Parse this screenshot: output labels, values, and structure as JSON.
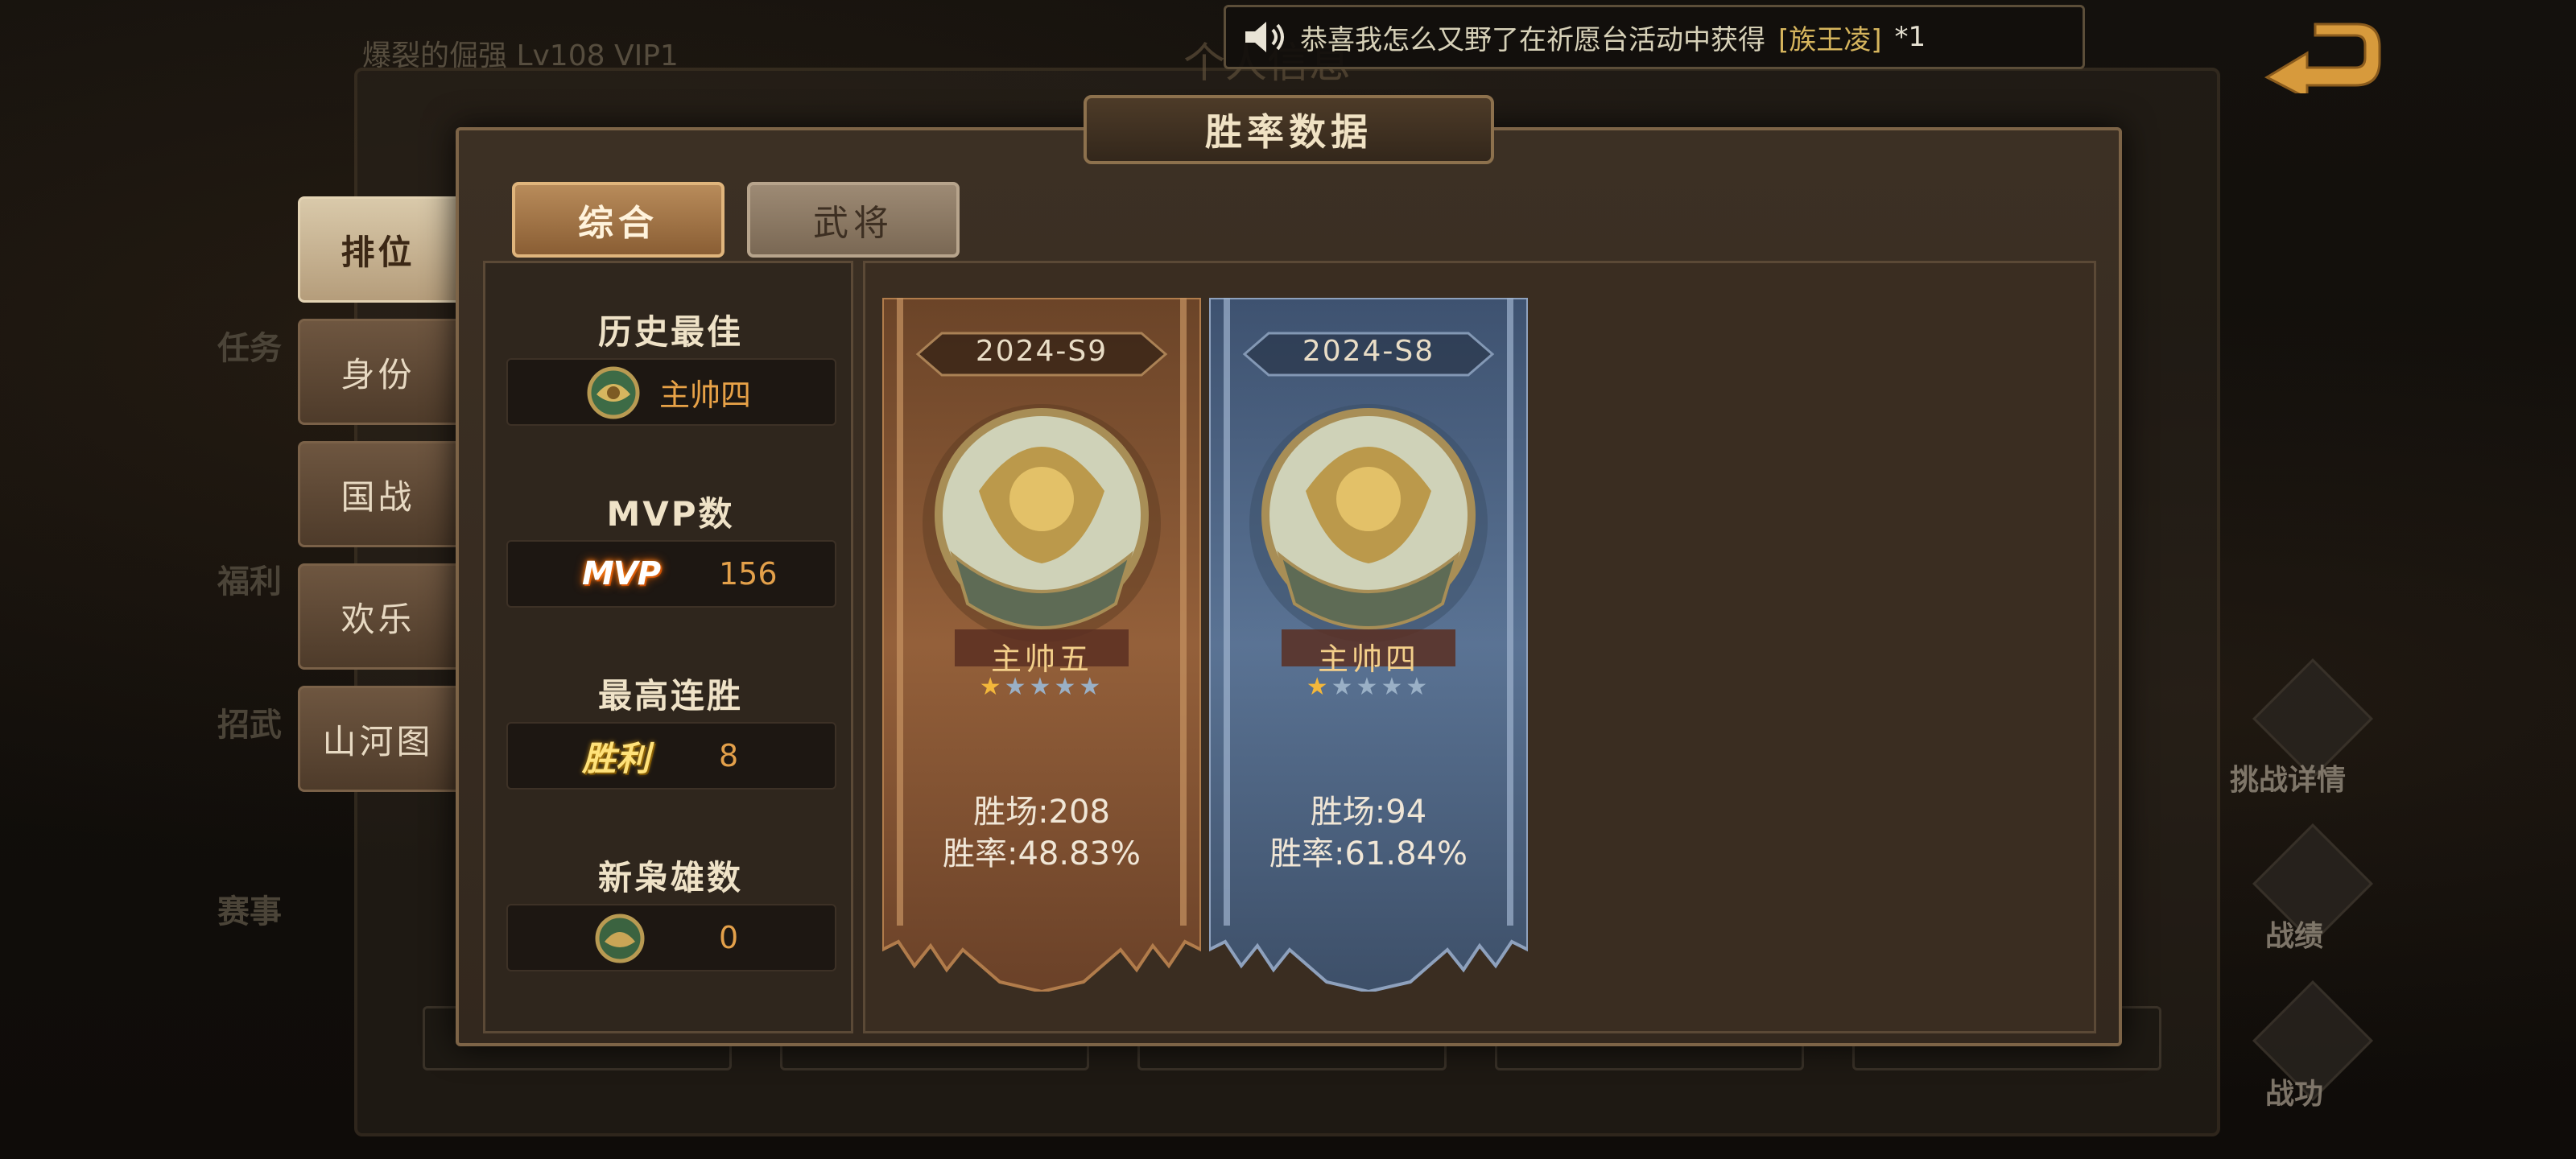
{
  "background": {
    "player_line": "爆裂的倔强 Lv108  VIP1",
    "window_title": "个人信息",
    "left_labels": [
      "任务",
      "福利",
      "招武",
      "赛事"
    ],
    "right_labels": [
      "挑战详情",
      "战绩",
      "战功"
    ]
  },
  "announcement": {
    "prefix": "恭喜我怎么又野了在祈愿台活动中获得",
    "item": "[族王凌]",
    "suffix": "*1"
  },
  "modal": {
    "title": "胜率数据"
  },
  "side_tabs": [
    "排位",
    "身份",
    "国战",
    "欢乐",
    "山河图"
  ],
  "top_tabs": [
    "综合",
    "武将"
  ],
  "stats": {
    "best": {
      "title": "历史最佳",
      "value": "主帅四"
    },
    "mvp": {
      "title": "MVP数",
      "tag": "MVP",
      "value": "156"
    },
    "streak": {
      "title": "最高连胜",
      "tag": "胜利",
      "value": "8"
    },
    "new_hero": {
      "title": "新枭雄数",
      "value": "0"
    }
  },
  "seasons": [
    {
      "season": "2024-S9",
      "rank": "主帅五",
      "stars_on": 1,
      "stars_total": 5,
      "wins": "胜场:208",
      "rate": "胜率:48.83%",
      "theme": "#8a5a35"
    },
    {
      "season": "2024-S8",
      "rank": "主帅四",
      "stars_on": 1,
      "stars_total": 5,
      "wins": "胜场:94",
      "rate": "胜率:61.84%",
      "theme": "#4f6788"
    }
  ],
  "colors": {
    "accent_orange": "#e3a04a",
    "banner_bronze": "#8a5a35",
    "banner_blue": "#4f6788"
  }
}
